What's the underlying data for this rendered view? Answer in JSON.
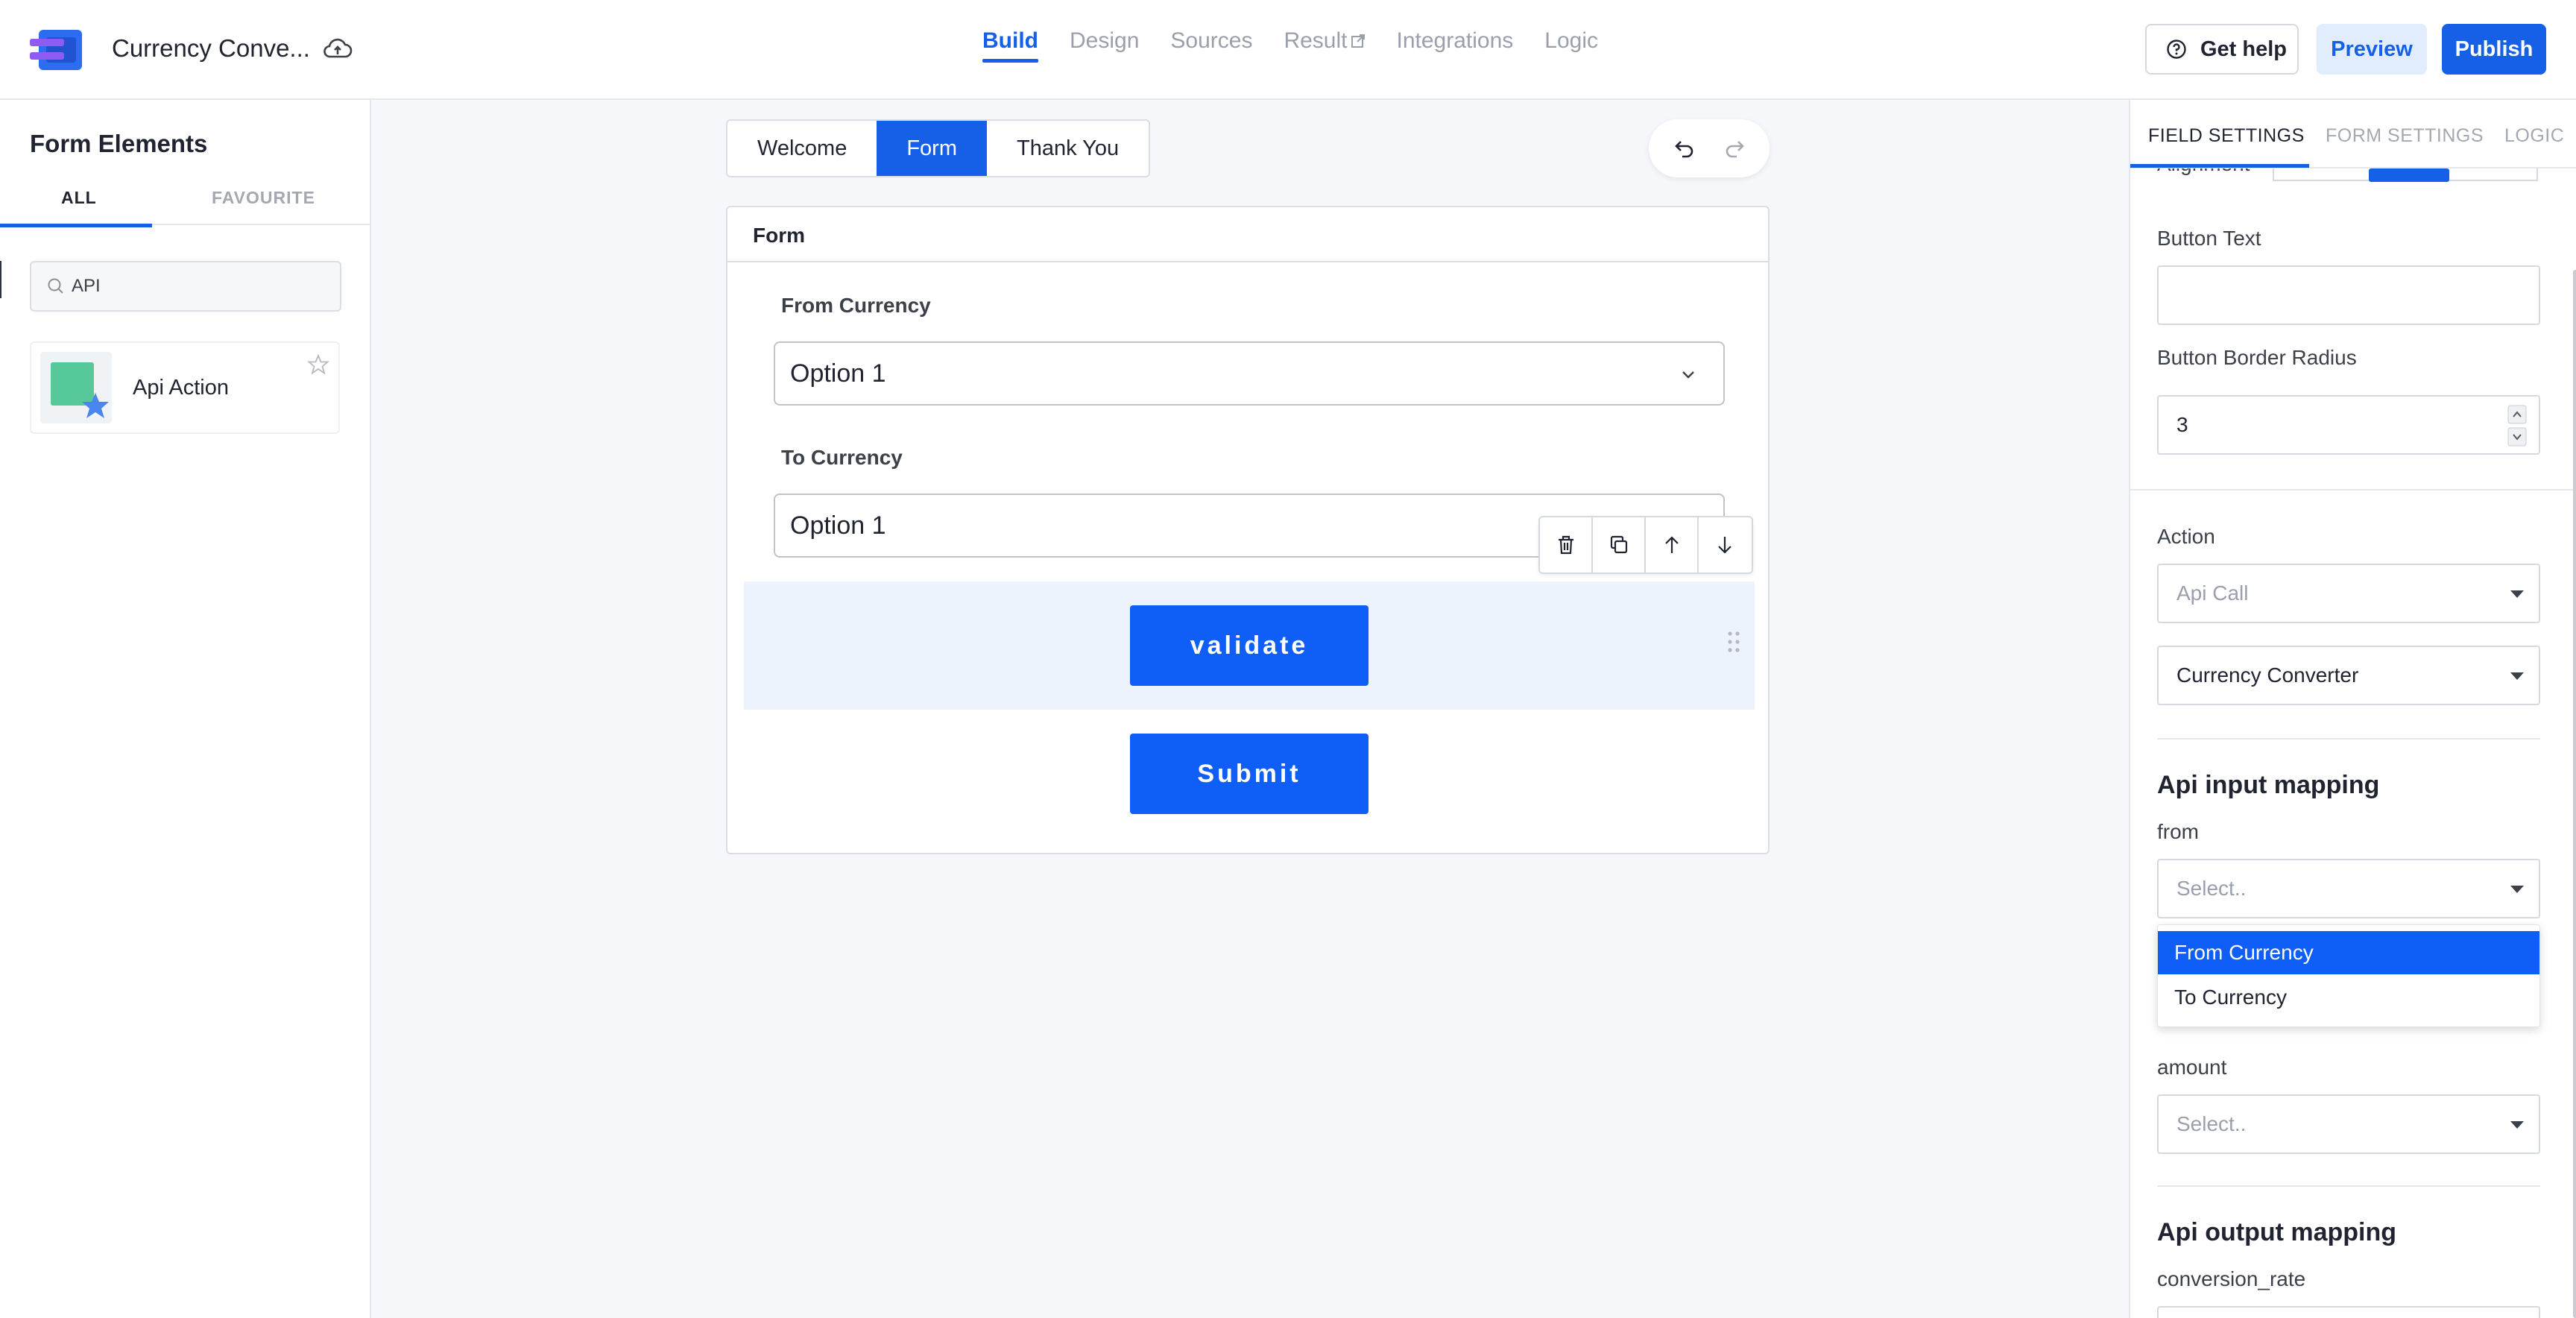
{
  "header": {
    "app_title": "Currency Conve...",
    "nav_tabs": [
      "Build",
      "Design",
      "Sources",
      "Result",
      "Integrations",
      "Logic"
    ],
    "active_tab": "Build",
    "get_help": "Get help",
    "preview": "Preview",
    "publish": "Publish",
    "colors": {
      "accent": "#1560e6",
      "preview_bg": "#e1edfc"
    }
  },
  "sidebar": {
    "title": "Form Elements",
    "tabs": [
      "ALL",
      "FAVOURITE"
    ],
    "active_tab": "ALL",
    "search_value": "API",
    "elements": [
      {
        "label": "Api Action",
        "icon": "api-action-icon"
      }
    ]
  },
  "canvas": {
    "page_tabs": [
      "Welcome",
      "Form",
      "Thank You"
    ],
    "active_page": "Form",
    "form_title": "Form",
    "fields": [
      {
        "label": "From Currency",
        "value": "Option 1"
      },
      {
        "label": "To Currency",
        "value": "Option 1"
      }
    ],
    "validate_button": "validate",
    "submit_button": "Submit",
    "button_color": "#0f5ef7"
  },
  "right_panel": {
    "tabs": [
      "FIELD SETTINGS",
      "FORM SETTINGS",
      "LOGIC"
    ],
    "active_tab": "FIELD SETTINGS",
    "alignment_label": "Alignment",
    "button_text_label": "Button Text",
    "button_text_value": "",
    "button_border_radius_label": "Button Border Radius",
    "button_border_radius_value": "3",
    "action_label": "Action",
    "action_value": "Api Call",
    "api_value": "Currency Converter",
    "input_mapping_title": "Api input mapping",
    "from_label": "from",
    "from_value": "Select..",
    "dropdown_options": [
      "From Currency",
      "To Currency"
    ],
    "dropdown_highlighted": "From Currency",
    "amount_label": "amount",
    "amount_value": "Select..",
    "output_mapping_title": "Api output mapping",
    "conversion_rate_label": "conversion_rate"
  }
}
